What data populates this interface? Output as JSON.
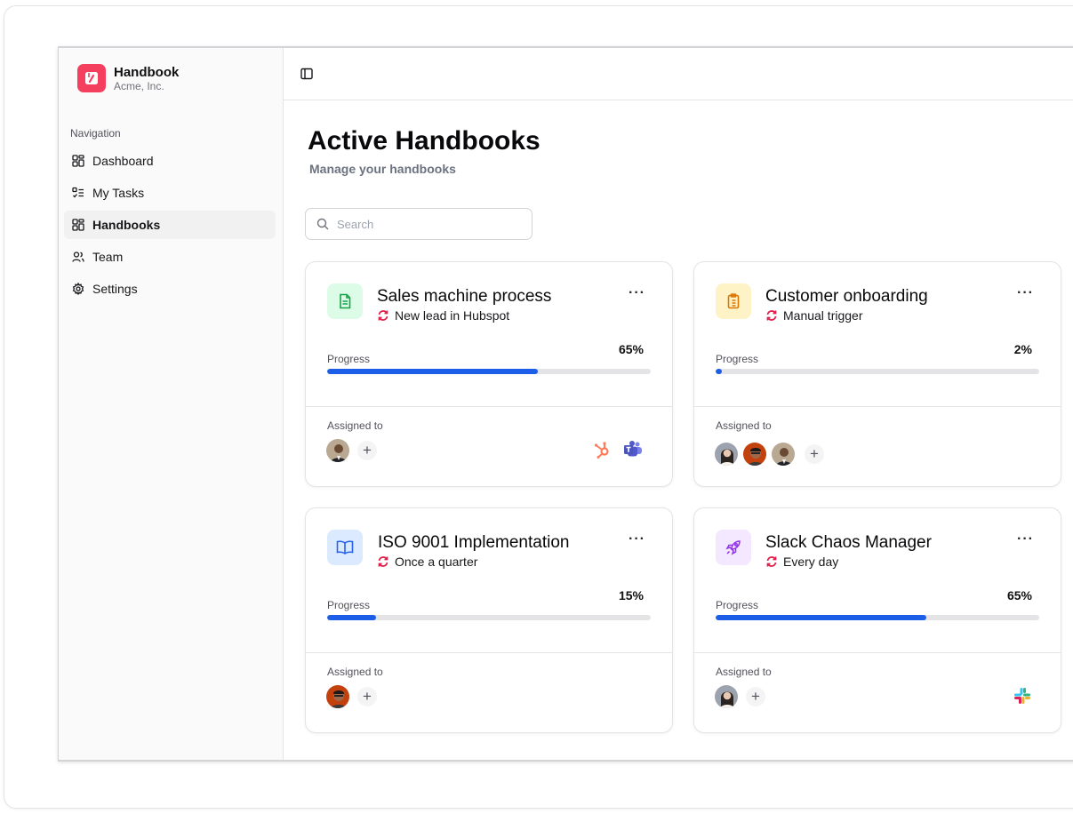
{
  "brand": {
    "name": "Handbook",
    "company": "Acme, Inc."
  },
  "nav": {
    "title": "Navigation",
    "items": [
      {
        "label": "Dashboard",
        "icon": "dashboard-icon"
      },
      {
        "label": "My Tasks",
        "icon": "tasks-icon"
      },
      {
        "label": "Handbooks",
        "icon": "grid-icon",
        "active": true
      },
      {
        "label": "Team",
        "icon": "users-icon"
      },
      {
        "label": "Settings",
        "icon": "gear-icon"
      }
    ]
  },
  "page": {
    "title": "Active Handbooks",
    "subtitle": "Manage your handbooks"
  },
  "search": {
    "placeholder": "Search"
  },
  "labels": {
    "progress": "Progress",
    "assigned": "Assigned to",
    "more": "···",
    "add": "+"
  },
  "colors": {
    "accent": "#1d5ee8",
    "brand": "#f43f5e",
    "trigger": "#e11d48"
  },
  "cards": [
    {
      "title": "Sales machine process",
      "trigger": "New lead in Hubspot",
      "progress": 65,
      "progress_text": "65%",
      "icon": "document-icon",
      "avatars": 1,
      "integrations": [
        "hubspot-icon",
        "teams-icon"
      ]
    },
    {
      "title": "Customer onboarding",
      "trigger": "Manual trigger",
      "progress": 2,
      "progress_text": "2%",
      "icon": "clipboard-icon",
      "avatars": 3,
      "integrations": []
    },
    {
      "title": "ISO 9001 Implementation",
      "trigger": "Once a quarter",
      "progress": 15,
      "progress_text": "15%",
      "icon": "book-icon",
      "avatars": 1,
      "integrations": []
    },
    {
      "title": "Slack Chaos Manager",
      "trigger": "Every day",
      "progress": 65,
      "progress_text": "65%",
      "icon": "rocket-icon",
      "avatars": 1,
      "integrations": [
        "slack-icon"
      ]
    }
  ]
}
